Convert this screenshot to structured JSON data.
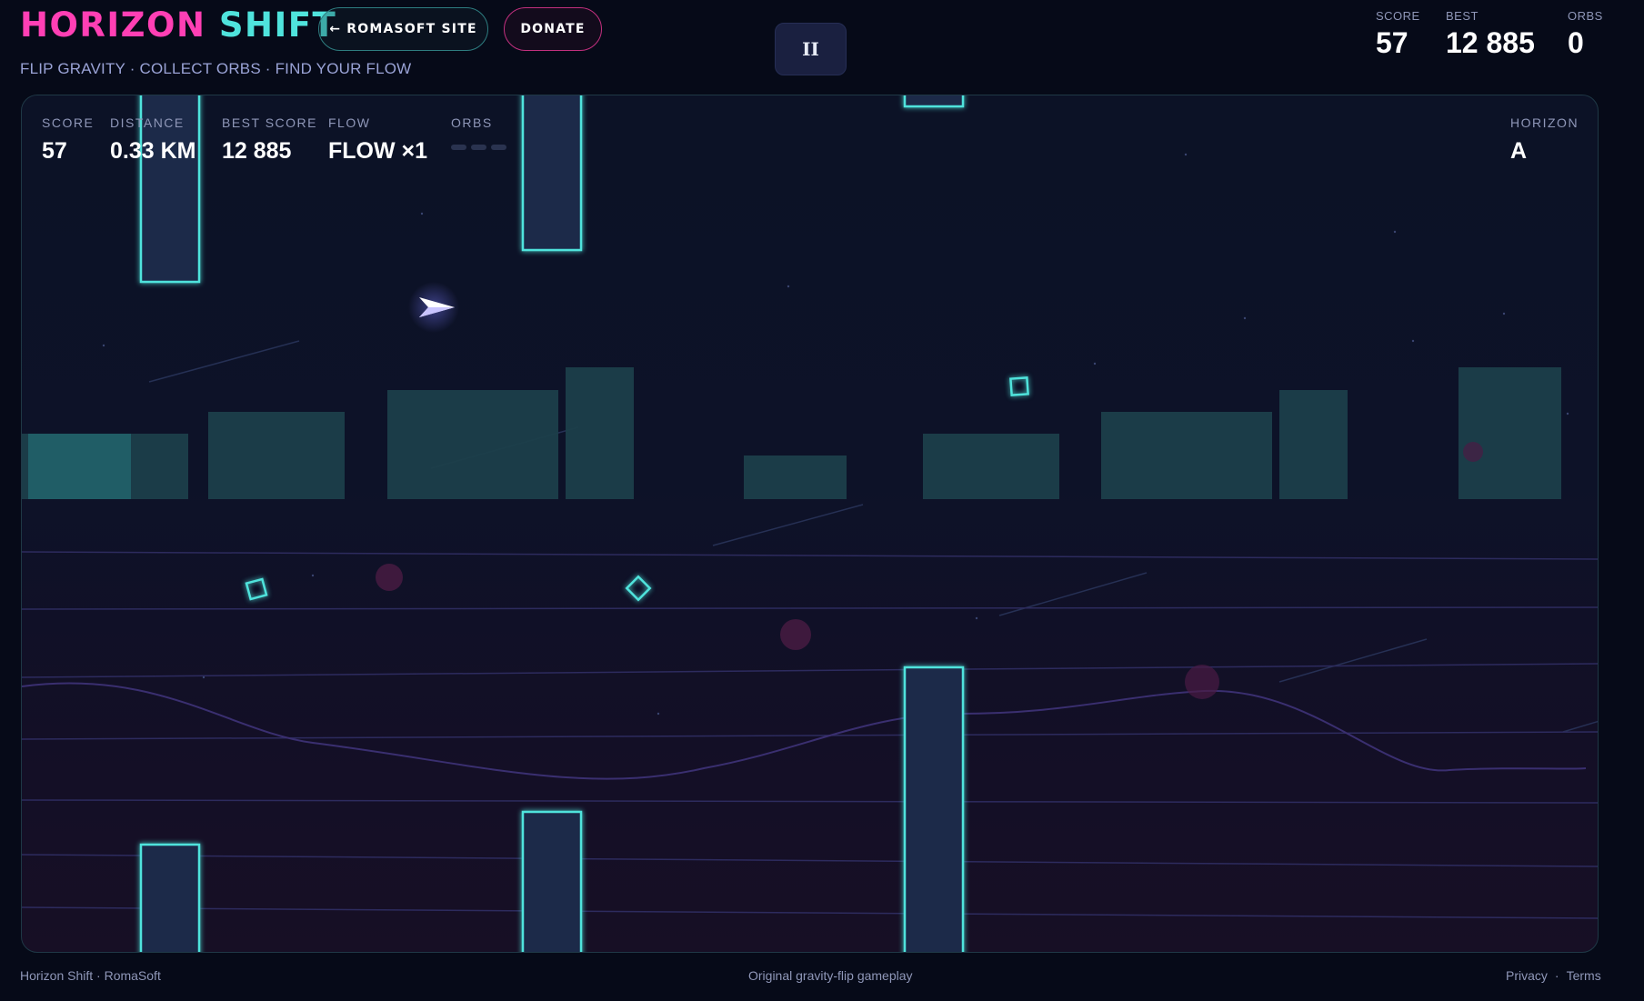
{
  "header": {
    "brand_part1": "HORIZON",
    "brand_part2": "SHIFT",
    "tagline": "FLIP GRAVITY · COLLECT ORBS · FIND YOUR FLOW",
    "site_button": "← ROMASOFT SITE",
    "donate_button": "DONATE",
    "pause_button": "II"
  },
  "top_stats": {
    "score_label": "SCORE",
    "score_value": "57",
    "best_label": "BEST",
    "best_value": "12 885",
    "orbs_label": "ORBS",
    "orbs_value": "0"
  },
  "hud": {
    "score_label": "SCORE",
    "score_value": "57",
    "distance_label": "DISTANCE",
    "distance_value": "0.33 KM",
    "best_label": "BEST SCORE",
    "best_value": "12 885",
    "flow_label": "FLOW",
    "flow_value": "FLOW ×1",
    "orbs_label": "ORBS",
    "orbs_collected": 0,
    "horizon_label": "HORIZON",
    "horizon_value": "A"
  },
  "footer": {
    "left": "Horizon Shift · RomaSoft",
    "center": "Original gravity-flip gameplay",
    "privacy": "Privacy",
    "separator": "·",
    "terms": "Terms"
  },
  "colors": {
    "accent_pink": "#ff3fb4",
    "accent_cyan": "#4fe3dc",
    "background": "#060a18"
  },
  "icons": {
    "player": "paper-plane-ship-icon",
    "orb": "diamond-orb-icon"
  }
}
